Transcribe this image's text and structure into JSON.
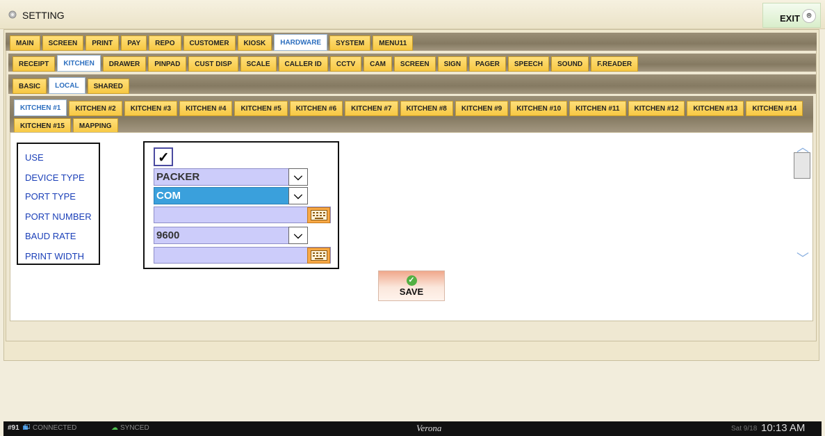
{
  "window": {
    "title": "SETTING",
    "exit_label": "EXIT"
  },
  "tabs_main": [
    "MAIN",
    "SCREEN",
    "PRINT",
    "PAY",
    "REPO",
    "CUSTOMER",
    "KIOSK",
    "HARDWARE",
    "SYSTEM",
    "MENU11"
  ],
  "tabs_hardware": [
    "RECEIPT",
    "KITCHEN",
    "DRAWER",
    "PINPAD",
    "CUST DISP",
    "SCALE",
    "CALLER ID",
    "CCTV",
    "CAM",
    "SCREEN",
    "SIGN",
    "PAGER",
    "SPEECH",
    "SOUND",
    "F.READER"
  ],
  "tabs_kitchen": [
    "BASIC",
    "LOCAL",
    "SHARED"
  ],
  "tabs_printers": [
    "KITCHEN #1",
    "KITCHEN #2",
    "KITCHEN #3",
    "KITCHEN #4",
    "KITCHEN #5",
    "KITCHEN #6",
    "KITCHEN #7",
    "KITCHEN #8",
    "KITCHEN #9",
    "KITCHEN #10",
    "KITCHEN #11",
    "KITCHEN #12",
    "KITCHEN #13",
    "KITCHEN #14",
    "KITCHEN #15",
    "MAPPING"
  ],
  "active": {
    "main": "HARDWARE",
    "hardware": "KITCHEN",
    "kitchen": "LOCAL",
    "printers": "KITCHEN #1"
  },
  "form": {
    "labels": {
      "use": "USE",
      "device_type": "DEVICE TYPE",
      "port_type": "PORT TYPE",
      "port_number": "PORT NUMBER",
      "baud_rate": "BAUD RATE",
      "print_width": "PRINT WIDTH"
    },
    "use_checked": true,
    "device_type": "PACKER",
    "port_type": "COM",
    "port_number": "",
    "baud_rate": "9600",
    "print_width": ""
  },
  "save_label": "SAVE",
  "status": {
    "station": "#91",
    "connected": "CONNECTED",
    "synced": "SYNCED",
    "location": "Verona",
    "date": "Sat 9/18",
    "time": "10:13 AM"
  },
  "colors": {
    "tab": "#f7c843",
    "field": "#ccccfa",
    "highlight": "#3aa0dc",
    "label": "#1a3fb8"
  }
}
